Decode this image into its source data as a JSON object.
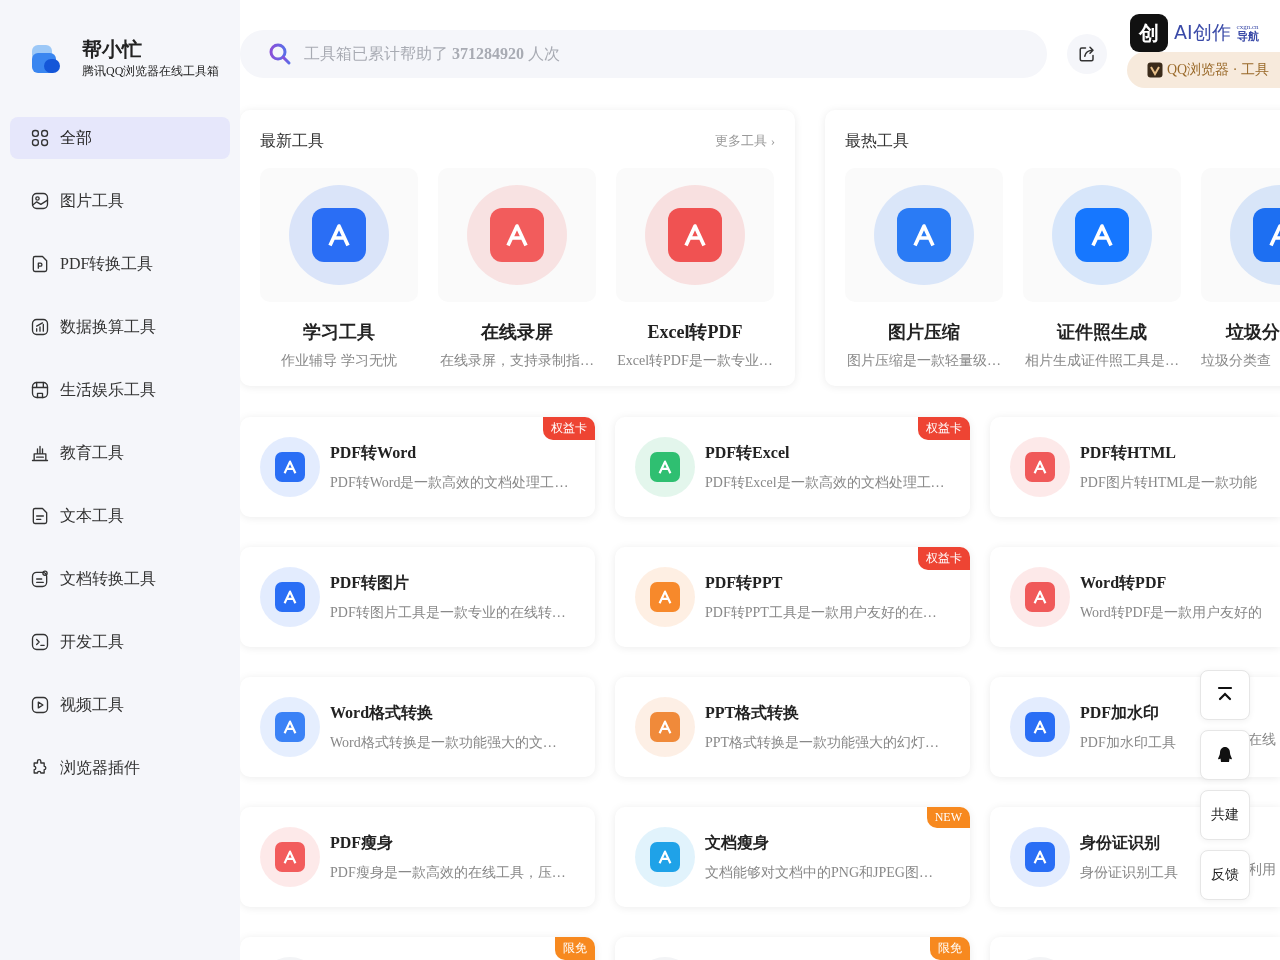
{
  "sidebar": {
    "logo": {
      "title": "帮小忙",
      "subtitle": "腾讯QQ浏览器在线工具箱"
    },
    "items": [
      {
        "label": "全部",
        "selected": true
      },
      {
        "label": "图片工具",
        "selected": false
      },
      {
        "label": "PDF转换工具",
        "selected": false
      },
      {
        "label": "数据换算工具",
        "selected": false
      },
      {
        "label": "生活娱乐工具",
        "selected": false
      },
      {
        "label": "教育工具",
        "selected": false
      },
      {
        "label": "文本工具",
        "selected": false
      },
      {
        "label": "文档转换工具",
        "selected": false
      },
      {
        "label": "开发工具",
        "selected": false
      },
      {
        "label": "视频工具",
        "selected": false
      },
      {
        "label": "浏览器插件",
        "selected": false
      }
    ]
  },
  "search": {
    "text": "工具箱已累计帮助了 **371284920** 人次"
  },
  "promo": {
    "icon_char": "创",
    "title": "AI创作",
    "domain": "cxgn.cn",
    "suffix": "导航",
    "pill": "QQ浏览器 · 工具"
  },
  "newest": {
    "title": "最新工具",
    "more": "更多工具 ›",
    "items": [
      {
        "title": "学习工具",
        "desc": "作业辅导 学习无忧",
        "color": "#2a6ef5"
      },
      {
        "title": "在线录屏",
        "desc": "在线录屏，支持录制指…",
        "color": "#f25c5c"
      },
      {
        "title": "Excel转PDF",
        "desc": "Excel转PDF是一款专业…",
        "color": "#f05252"
      }
    ]
  },
  "hottest": {
    "title": "最热工具",
    "items": [
      {
        "title": "图片压缩",
        "desc": "图片压缩是一款轻量级…",
        "color": "#2a7bf5"
      },
      {
        "title": "证件照生成",
        "desc": "相片生成证件照工具是…",
        "color": "#1677ff"
      },
      {
        "title": "垃圾分",
        "desc": "垃圾分类查",
        "color": "#1d6ff2"
      }
    ]
  },
  "tools": [
    {
      "title": "PDF转Word",
      "desc": "PDF转Word是一款高效的文档处理工…",
      "color": "#2a6ef5",
      "badge": {
        "text": "权益卡",
        "color": "#ee4433"
      }
    },
    {
      "title": "PDF转Excel",
      "desc": "PDF转Excel是一款高效的文档处理工…",
      "color": "#2fbf71",
      "badge": {
        "text": "权益卡",
        "color": "#ee4433"
      }
    },
    {
      "title": "PDF转HTML",
      "desc": "PDF图片转HTML是一款功能",
      "color": "#f05a5a"
    },
    {
      "title": "PDF转图片",
      "desc": "PDF转图片工具是一款专业的在线转…",
      "color": "#2a6ef5"
    },
    {
      "title": "PDF转PPT",
      "desc": "PDF转PPT工具是一款用户友好的在…",
      "color": "#f7892b",
      "badge": {
        "text": "权益卡",
        "color": "#ee4433"
      }
    },
    {
      "title": "Word转PDF",
      "desc": "Word转PDF是一款用户友好的",
      "color": "#f05a5a"
    },
    {
      "title": "Word格式转换",
      "desc": "Word格式转换是一款功能强大的文…",
      "color": "#3b82f6"
    },
    {
      "title": "PPT格式转换",
      "desc": "PPT格式转换是一款功能强大的幻灯…",
      "color": "#f08a3a"
    },
    {
      "title": "PDF加水印",
      "desc": "PDF加水印工具",
      "desc_tail": "在线",
      "color": "#2a6ef5"
    },
    {
      "title": "PDF瘦身",
      "desc": "PDF瘦身是一款高效的在线工具，压…",
      "color": "#f25c5c"
    },
    {
      "title": "文档瘦身",
      "desc": "文档能够对文档中的PNG和JPEG图…",
      "color": "#1fa2e8",
      "badge": {
        "text": "NEW",
        "color": "#f7891f"
      }
    },
    {
      "title": "身份证识别",
      "desc": "身份证识别工具",
      "desc_tail": "利用",
      "color": "#2a6ef5"
    },
    {
      "badge": {
        "text": "限免",
        "color": "#f7891f"
      }
    },
    {
      "badge": {
        "text": "限免",
        "color": "#f7891f"
      }
    }
  ],
  "float_buttons": [
    {
      "kind": "top"
    },
    {
      "kind": "qq"
    },
    {
      "kind": "text",
      "label": "共建"
    },
    {
      "kind": "text",
      "label": "反馈"
    }
  ]
}
